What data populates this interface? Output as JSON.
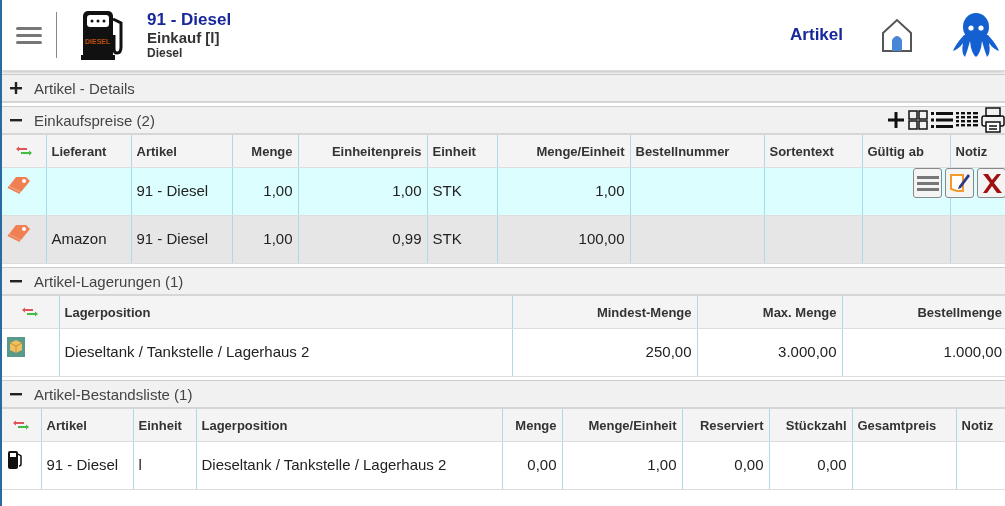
{
  "header": {
    "title": "91 - Diesel",
    "subtitle": "Einkauf [l]",
    "caption": "Diesel",
    "logo_label": "DIESEL",
    "nav_link": "Artikel"
  },
  "sections": [
    {
      "title": "Artikel - Details",
      "expanded": false
    },
    {
      "title": "Einkaufspreise (2)",
      "expanded": true,
      "toolbar": true,
      "columns": [
        "Lieferant",
        "Artikel",
        "Menge",
        "Einheitenpreis",
        "Einheit",
        "Menge/Einheit",
        "Bestellnummer",
        "Sortentext",
        "Gültig ab",
        "Notiz"
      ],
      "rows": [
        {
          "kind": "price-tag",
          "selected": true,
          "cells": [
            "",
            "91 - Diesel",
            "1,00",
            "1,00",
            "STK",
            "1,00",
            "",
            "",
            "",
            ""
          ]
        },
        {
          "kind": "price-tag",
          "selected": false,
          "cells": [
            "Amazon",
            "91 - Diesel",
            "1,00",
            "0,99",
            "STK",
            "100,00",
            "",
            "",
            "",
            ""
          ]
        }
      ]
    },
    {
      "title": "Artikel-Lagerungen (1)",
      "expanded": true,
      "columns": [
        "Lagerposition",
        "Mindest-Menge",
        "Max. Menge",
        "Bestellmenge"
      ],
      "rows": [
        {
          "kind": "box",
          "selected": false,
          "cells": [
            "Dieseltank / Tankstelle / Lagerhaus 2",
            "250,00",
            "3.000,00",
            "1.000,00"
          ]
        }
      ]
    },
    {
      "title": "Artikel-Bestandsliste (1)",
      "expanded": true,
      "columns": [
        "Artikel",
        "Einheit",
        "Lagerposition",
        "Menge",
        "Menge/Einheit",
        "Reserviert",
        "Stückzahl",
        "Gesamtpreis",
        "Notiz"
      ],
      "rows": [
        {
          "kind": "pump",
          "selected": false,
          "cells": [
            "91 - Diesel",
            "l",
            "Dieseltank / Tankstelle / Lagerhaus 2",
            "0,00",
            "1,00",
            "0,00",
            "0,00",
            "",
            ""
          ]
        }
      ]
    }
  ]
}
